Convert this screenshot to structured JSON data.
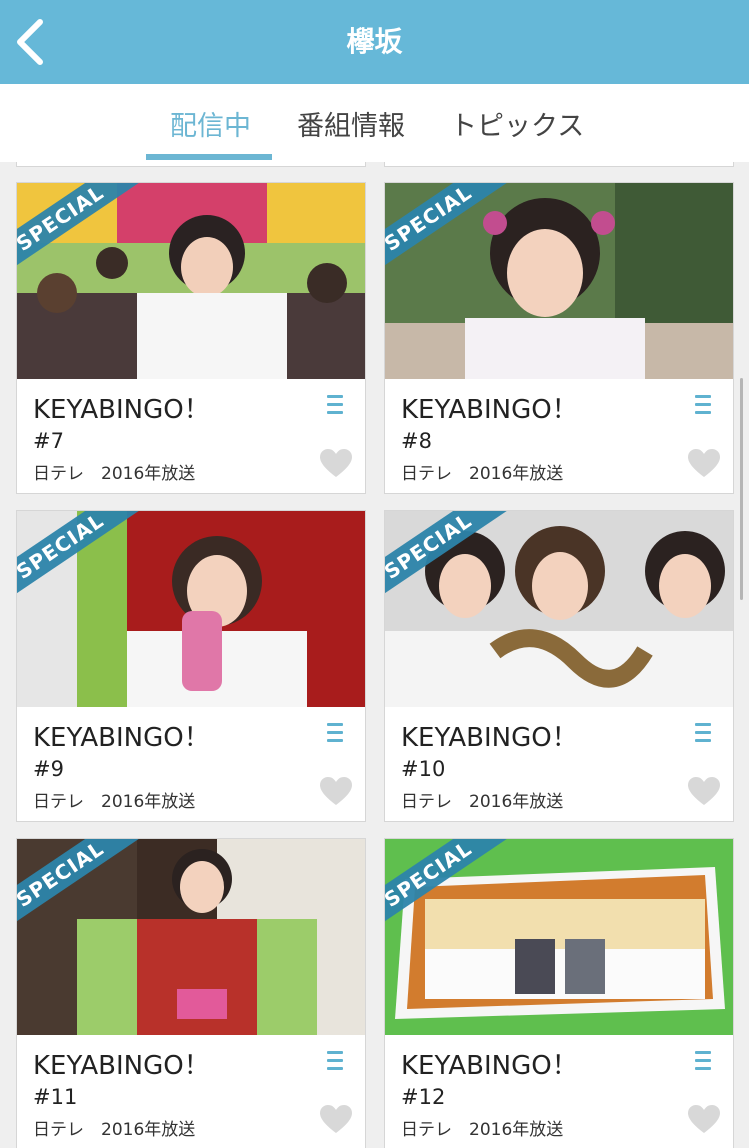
{
  "header": {
    "title": "欅坂",
    "back_icon": "chevron-left-icon",
    "background": "#66b8d8"
  },
  "tabs": [
    {
      "label": "配信中",
      "active": true
    },
    {
      "label": "番組情報",
      "active": false
    },
    {
      "label": "トピックス",
      "active": false
    }
  ],
  "accent_color": "#6cb6d3",
  "badge_label": "SPECIAL",
  "episodes": [
    {
      "title": "KEYABINGO！",
      "episode": "#7",
      "meta": "日テレ　2016年放送",
      "favorite": false
    },
    {
      "title": "KEYABINGO！",
      "episode": "#8",
      "meta": "日テレ　2016年放送",
      "favorite": false
    },
    {
      "title": "KEYABINGO！",
      "episode": "#9",
      "meta": "日テレ　2016年放送",
      "favorite": false
    },
    {
      "title": "KEYABINGO！",
      "episode": "#10",
      "meta": "日テレ　2016年放送",
      "favorite": false
    },
    {
      "title": "KEYABINGO！",
      "episode": "#11",
      "meta": "日テレ　2016年放送",
      "favorite": false
    },
    {
      "title": "KEYABINGO！",
      "episode": "#12",
      "meta": "日テレ　2016年放送",
      "favorite": false
    }
  ]
}
